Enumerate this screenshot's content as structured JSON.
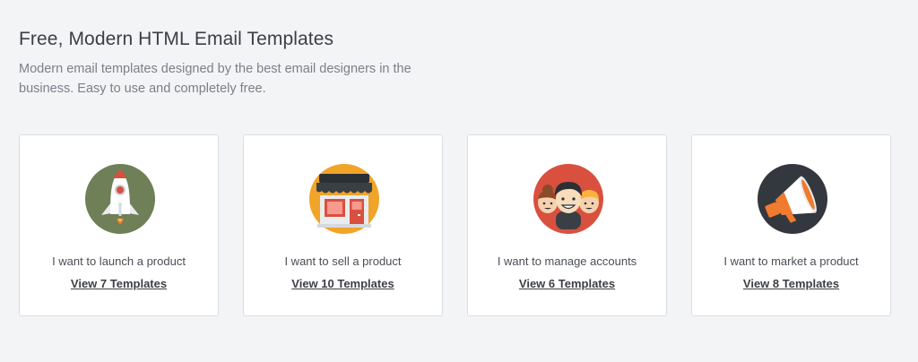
{
  "header": {
    "title": "Free, Modern HTML Email Templates",
    "subtitle": "Modern email templates designed by the best email designers in the business. Easy to use and completely free."
  },
  "cards": [
    {
      "icon": "rocket-icon",
      "label": "I want to launch a product",
      "link": "View 7 Templates"
    },
    {
      "icon": "storefront-icon",
      "label": "I want to sell a product",
      "link": "View 10 Templates"
    },
    {
      "icon": "people-icon",
      "label": "I want to manage accounts",
      "link": "View 6 Templates"
    },
    {
      "icon": "megaphone-icon",
      "label": "I want to market a product",
      "link": "View 8 Templates"
    }
  ],
  "colors": {
    "background": "#f3f4f6",
    "rocket_circle": "#6f7f57",
    "store_circle": "#f0a42a",
    "people_circle": "#d9503f",
    "megaphone_circle": "#33383e",
    "accent_orange": "#f07a2e"
  }
}
